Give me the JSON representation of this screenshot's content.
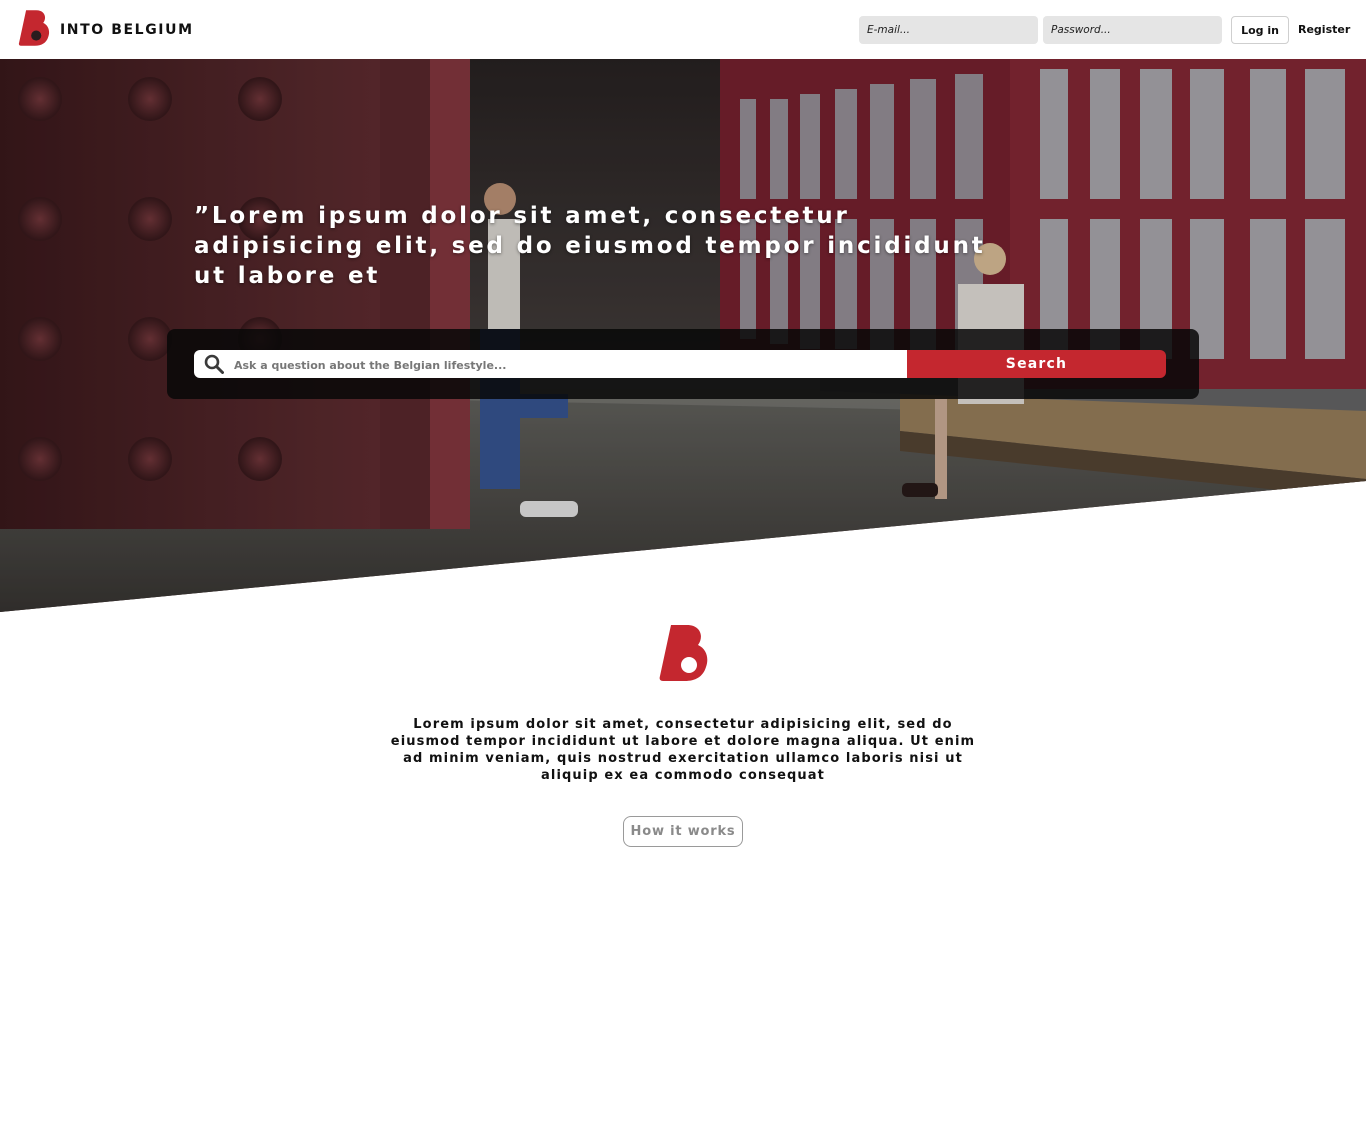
{
  "brand": {
    "name": "INTO BELGIUM",
    "accent_color": "#c4272f",
    "logo_icon": "b-logo-icon"
  },
  "header": {
    "email_placeholder": "E-mail...",
    "password_placeholder": "Password...",
    "login_label": "Log in",
    "register_label": "Register"
  },
  "hero": {
    "quote": "”Lorem ipsum dolor sit amet, consectetur adipisicing elit, sed do eiusmod tempor incididunt ut labore et",
    "search_placeholder": "Ask a question about the Belgian lifestyle...",
    "search_icon": "search-icon",
    "search_label": "Search"
  },
  "intro": {
    "text": "Lorem ipsum dolor sit amet, consectetur adipisicing elit, sed do eiusmod tempor incididunt ut labore et dolore magna aliqua. Ut enim ad minim veniam, quis nostrud exercitation ullamco laboris nisi ut aliquip ex ea commodo consequat",
    "button_label": "How it works"
  }
}
